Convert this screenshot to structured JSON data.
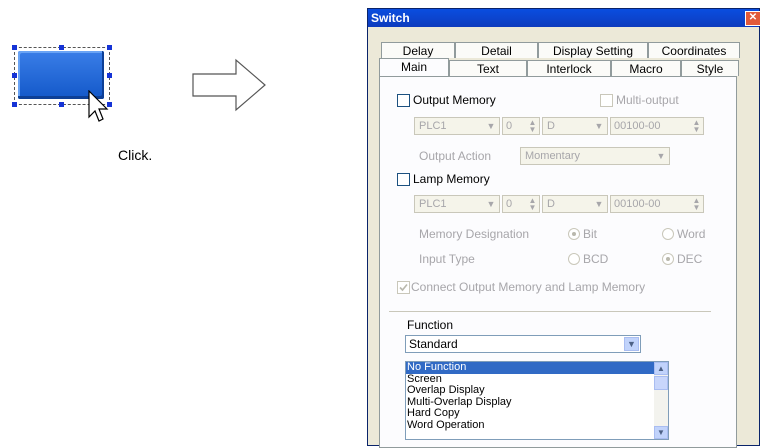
{
  "illustration": {
    "caption": "Click."
  },
  "dialog": {
    "title": "Switch",
    "tabs_back": [
      "Delay",
      "Detail",
      "Display Setting",
      "Coordinates"
    ],
    "tabs_front": [
      "Main",
      "Text",
      "Interlock",
      "Macro",
      "Style"
    ],
    "active_tab": "Main",
    "output_memory": {
      "label": "Output Memory",
      "multi_output_label": "Multi-output",
      "device": "PLC1",
      "station": "0",
      "type": "D",
      "address": "00100-00",
      "action_label": "Output Action",
      "action_value": "Momentary"
    },
    "lamp_memory": {
      "label": "Lamp Memory",
      "device": "PLC1",
      "station": "0",
      "type": "D",
      "address": "00100-00"
    },
    "memory_designation": {
      "label": "Memory Designation",
      "options": [
        "Bit",
        "Word"
      ]
    },
    "input_type": {
      "label": "Input Type",
      "options": [
        "BCD",
        "DEC"
      ]
    },
    "connect_label": "Connect Output Memory and Lamp Memory",
    "function": {
      "label": "Function",
      "selected": "Standard",
      "list": [
        "No Function",
        "Screen",
        "Overlap Display",
        "Multi-Overlap Display",
        "Hard Copy",
        "Word Operation"
      ],
      "highlighted": "No Function"
    }
  },
  "colors": {
    "titlebar": "#0a4ee0",
    "dialog_bg": "#ece9d8",
    "selection": "#316ac5",
    "demo_button": "#1358c9"
  }
}
